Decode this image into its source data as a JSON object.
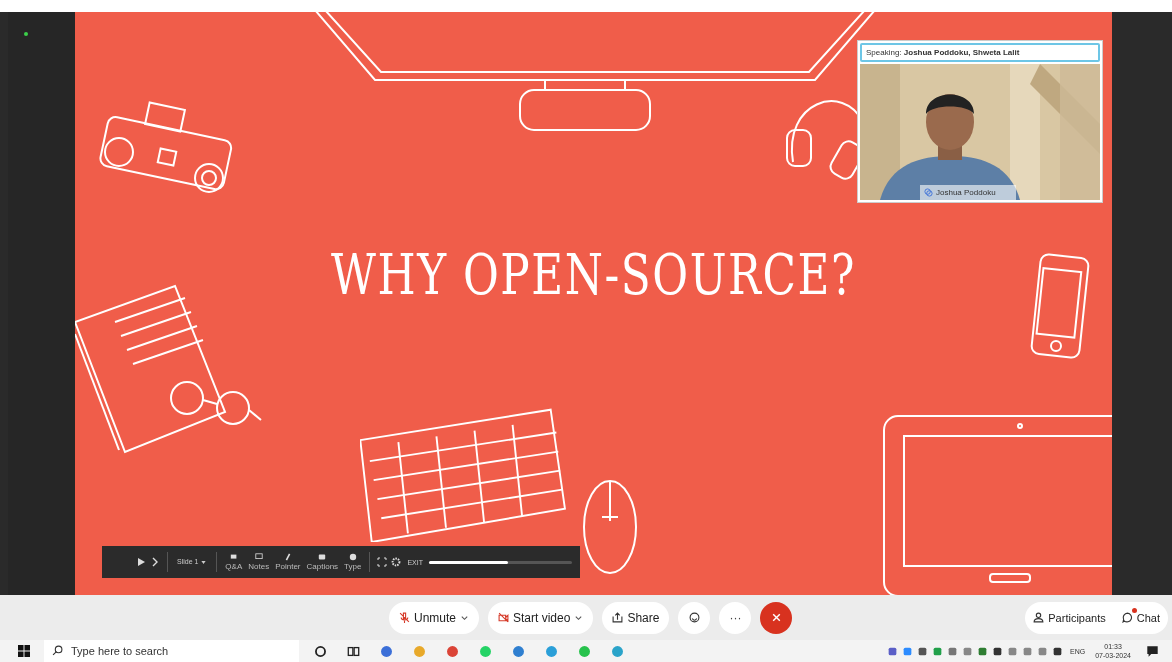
{
  "slide": {
    "title": "WHY OPEN-SOURCE?"
  },
  "presenter_toolbar": {
    "slide_picker": "Slide 1",
    "tools": [
      {
        "label": "Q&A",
        "kind": "qa"
      },
      {
        "label": "Notes",
        "kind": "notes"
      },
      {
        "label": "Pointer",
        "kind": "pointer"
      },
      {
        "label": "Captions",
        "kind": "captions"
      },
      {
        "label": "Type",
        "kind": "type"
      }
    ],
    "exit": "EXIT",
    "level": 0.55
  },
  "video_tile": {
    "speaking": "Speaking: **Joshua Poddoku, Shweta Lalit**",
    "name": "Joshua Poddoku",
    "kind": "picture"
  },
  "meeting_controls": [
    {
      "kind": "unmute",
      "label": "Unmute"
    },
    {
      "kind": "video",
      "label": "Start video"
    },
    {
      "kind": "share",
      "label": "Share"
    },
    {
      "kind": "reactions"
    },
    {
      "kind": "more",
      "label": "···"
    },
    {
      "kind": "leave"
    }
  ],
  "side_buttons": [
    {
      "kind": "participants",
      "label": "Participants",
      "unread": false
    },
    {
      "kind": "chat",
      "label": "Chat",
      "unread": true
    }
  ],
  "taskbar": {
    "search_placeholder": "Type here to search",
    "language": "ENG",
    "time": "01:33",
    "date": "07-03-2024"
  }
}
